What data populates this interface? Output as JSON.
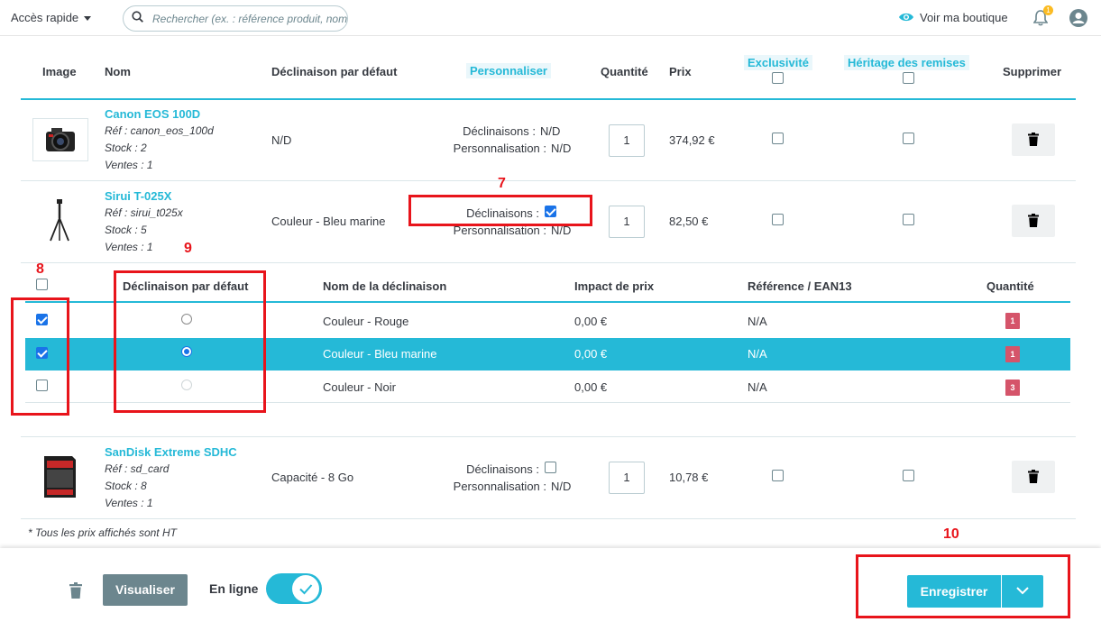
{
  "topbar": {
    "quick_access": "Accès rapide",
    "search_placeholder": "Rechercher (ex. : référence produit, nom",
    "view_shop": "Voir ma boutique",
    "notif_count": "1"
  },
  "table": {
    "headers": {
      "image": "Image",
      "name": "Nom",
      "default_combination": "Déclinaison par défaut",
      "customize": "Personnaliser",
      "quantity": "Quantité",
      "price": "Prix",
      "exclusivity": "Exclusivité",
      "discount_inheritance": "Héritage des remises",
      "delete": "Supprimer"
    },
    "products": [
      {
        "name": "Canon EOS 100D",
        "ref": "Réf : canon_eos_100d",
        "stock": "Stock : 2",
        "sales": "Ventes : 1",
        "default_combination": "N/D",
        "combinations_label": "Déclinaisons :",
        "combinations_value": "N/D",
        "customization_label": "Personnalisation :",
        "customization_value": "N/D",
        "quantity": "1",
        "price": "374,92 €"
      },
      {
        "name": "Sirui T-025X",
        "ref": "Réf : sirui_t025x",
        "stock": "Stock : 5",
        "sales": "Ventes : 1",
        "default_combination": "Couleur - Bleu marine",
        "combinations_label": "Déclinaisons :",
        "combinations_checked": true,
        "customization_label": "Personnalisation :",
        "customization_value": "N/D",
        "quantity": "1",
        "price": "82,50 €"
      },
      {
        "name": "SanDisk Extreme SDHC",
        "ref": "Réf : sd_card",
        "stock": "Stock : 8",
        "sales": "Ventes : 1",
        "default_combination": "Capacité - 8 Go",
        "combinations_label": "Déclinaisons :",
        "combinations_checked": false,
        "customization_label": "Personnalisation :",
        "customization_value": "N/D",
        "quantity": "1",
        "price": "10,78 €"
      }
    ]
  },
  "combinations": {
    "headers": {
      "default": "Déclinaison par défaut",
      "name": "Nom de la déclinaison",
      "price_impact": "Impact de prix",
      "reference": "Référence / EAN13",
      "quantity": "Quantité"
    },
    "rows": [
      {
        "name": "Couleur - Rouge",
        "impact": "0,00 €",
        "reference": "N/A",
        "quantity": "1",
        "checked": true,
        "default": false
      },
      {
        "name": "Couleur - Bleu marine",
        "impact": "0,00 €",
        "reference": "N/A",
        "quantity": "1",
        "checked": true,
        "default": true
      },
      {
        "name": "Couleur - Noir",
        "impact": "0,00 €",
        "reference": "N/A",
        "quantity": "3",
        "checked": false,
        "default": false
      }
    ]
  },
  "annotations": [
    "7",
    "8",
    "9",
    "10"
  ],
  "footnote": "* Tous les prix affichés sont HT",
  "footer": {
    "preview": "Visualiser",
    "online": "En ligne",
    "online_on": true,
    "save": "Enregistrer"
  },
  "colors": {
    "accent": "#25b9d7",
    "annotation": "#e8141b",
    "badge": "#d5546a"
  }
}
